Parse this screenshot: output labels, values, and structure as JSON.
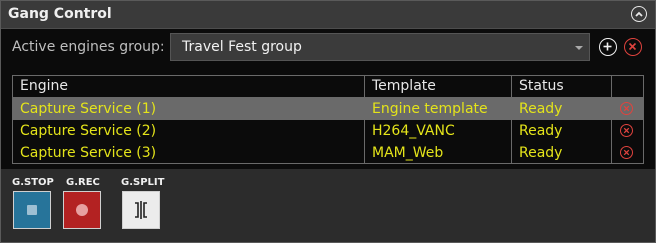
{
  "panel": {
    "title": "Gang Control"
  },
  "group": {
    "label": "Active engines group:",
    "selected": "Travel Fest group"
  },
  "table": {
    "columns": [
      "Engine",
      "Template",
      "Status"
    ],
    "rows": [
      {
        "engine": "Capture Service (1)",
        "template": "Engine template",
        "status": "Ready"
      },
      {
        "engine": "Capture Service (2)",
        "template": "H264_VANC",
        "status": "Ready"
      },
      {
        "engine": "Capture Service (3)",
        "template": "MAM_Web",
        "status": "Ready"
      }
    ]
  },
  "gang_buttons": {
    "stop_label": "G.STOP",
    "rec_label": "G.REC",
    "split_label": "G.SPLIT"
  },
  "colors": {
    "row_text": "#e4e41a",
    "selected_row": "#6a6a6a",
    "delete_red": "#e0433e",
    "stop_blue": "#27749a",
    "rec_red": "#b32222"
  },
  "icons": [
    "collapse-up-icon",
    "add-circle-icon",
    "delete-circle-icon",
    "stop-icon",
    "record-icon",
    "split-icon"
  ]
}
